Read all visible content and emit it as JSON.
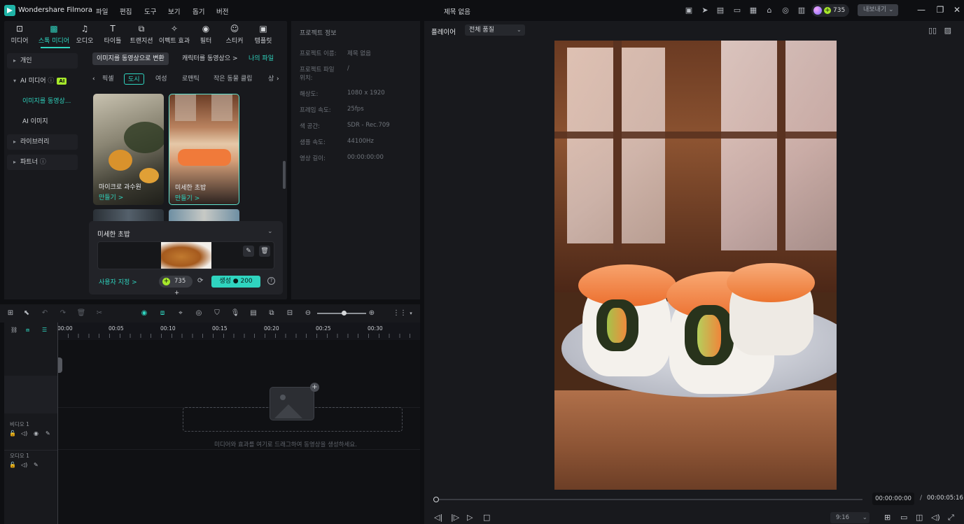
{
  "app": {
    "name": "Wondershare Filmora",
    "document_title": "제목 없음"
  },
  "menu": [
    "파일",
    "편집",
    "도구",
    "보기",
    "돕기",
    "버전"
  ],
  "credits": {
    "value": "735"
  },
  "export_label": "내보내기",
  "top_tabs": [
    {
      "label": "미디어",
      "icon": "media-icon"
    },
    {
      "label": "스톡 미디어",
      "icon": "stock-media-icon"
    },
    {
      "label": "오디오",
      "icon": "audio-icon"
    },
    {
      "label": "타이틀",
      "icon": "title-icon"
    },
    {
      "label": "트랜지션",
      "icon": "transition-icon"
    },
    {
      "label": "이펙트 효과",
      "icon": "effects-icon"
    },
    {
      "label": "필터",
      "icon": "filter-icon"
    },
    {
      "label": "스티커",
      "icon": "sticker-icon"
    },
    {
      "label": "템플릿",
      "icon": "template-icon"
    }
  ],
  "sidebar": {
    "items": [
      {
        "label": "개인"
      },
      {
        "label": "AI 미디어",
        "badge": "AI"
      },
      {
        "label": "이미지를 동영상..."
      },
      {
        "label": "AI 이미지"
      },
      {
        "label": "라이브러리"
      },
      {
        "label": "파트너"
      }
    ]
  },
  "subtabs": [
    "이미지를 동영상으로 변환",
    "캐릭터를 동영상으 >",
    "나의 파일"
  ],
  "categories": [
    "픽셀",
    "도시",
    "여성",
    "로맨틱",
    "작은 동물 클립",
    "상"
  ],
  "cards": [
    {
      "caption": "마이크로 과수원",
      "make": "만들기 >"
    },
    {
      "caption": "미세한 초밥",
      "make": "만들기 >"
    }
  ],
  "generator": {
    "title": "미세한 초밥",
    "custom_label": "사용자 지정 >",
    "cost": "735",
    "generate_label": "생성",
    "generate_cost": "200"
  },
  "project_info": {
    "title": "프로젝트 정보",
    "rows": [
      {
        "key": "프로젝트 이름:",
        "value": "제목 없음"
      },
      {
        "key": "프로젝트 파일 위치:",
        "value": "/"
      },
      {
        "key": "해상도:",
        "value": "1080 x 1920"
      },
      {
        "key": "프레임 속도:",
        "value": "25fps"
      },
      {
        "key": "색 공간:",
        "value": "SDR - Rec.709"
      },
      {
        "key": "샘플 속도:",
        "value": "44100Hz"
      },
      {
        "key": "영상 길이:",
        "value": "00:00:00:00"
      }
    ]
  },
  "player": {
    "label": "플레이어",
    "quality": "전체 품질",
    "current_time": "00:00:00:00",
    "separator": "/",
    "duration": "00:00:05:16",
    "ratio": "9:16"
  },
  "timeline": {
    "ticks": [
      "00:00",
      "00:05",
      "00:10",
      "00:15",
      "00:20",
      "00:25",
      "00:30"
    ],
    "tracks": [
      {
        "label": "비디오 1"
      },
      {
        "label": "오디오 1"
      }
    ],
    "drop_text": "미디어와 효과를 여기로 드래그하여 동영상을 생성하세요."
  }
}
